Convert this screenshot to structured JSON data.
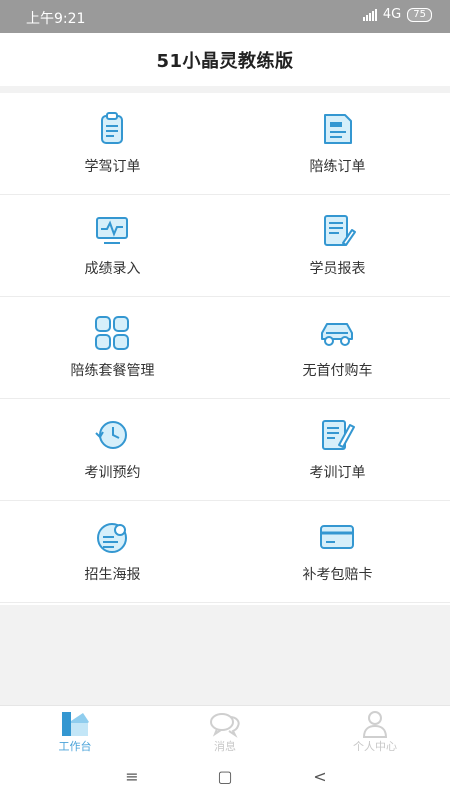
{
  "status_bar": {
    "time": "上午9:21",
    "network": "4G",
    "battery": "75"
  },
  "header": {
    "title": "51小晶灵教练版"
  },
  "colors": {
    "accent": "#4ba3d9",
    "icon_fill": "#d6effa",
    "icon_stroke": "#3497d1"
  },
  "menu": [
    {
      "label": "学驾订单",
      "icon": "clipboard-icon"
    },
    {
      "label": "陪练订单",
      "icon": "document-icon"
    },
    {
      "label": "成绩录入",
      "icon": "monitor-pulse-icon"
    },
    {
      "label": "学员报表",
      "icon": "report-pen-icon"
    },
    {
      "label": "陪练套餐管理",
      "icon": "grid-apps-icon"
    },
    {
      "label": "无首付购车",
      "icon": "car-icon"
    },
    {
      "label": "考训预约",
      "icon": "history-clock-icon"
    },
    {
      "label": "考训订单",
      "icon": "order-pen-icon"
    },
    {
      "label": "招生海报",
      "icon": "poster-icon"
    },
    {
      "label": "补考包赔卡",
      "icon": "card-icon"
    }
  ],
  "tabs": [
    {
      "label": "工作台",
      "icon": "workbench-icon",
      "active": true
    },
    {
      "label": "消息",
      "icon": "chat-bubbles-icon",
      "active": false
    },
    {
      "label": "个人中心",
      "icon": "user-icon",
      "active": false
    }
  ],
  "nav": {
    "menu": "≡",
    "home": "▢",
    "back": "<"
  }
}
